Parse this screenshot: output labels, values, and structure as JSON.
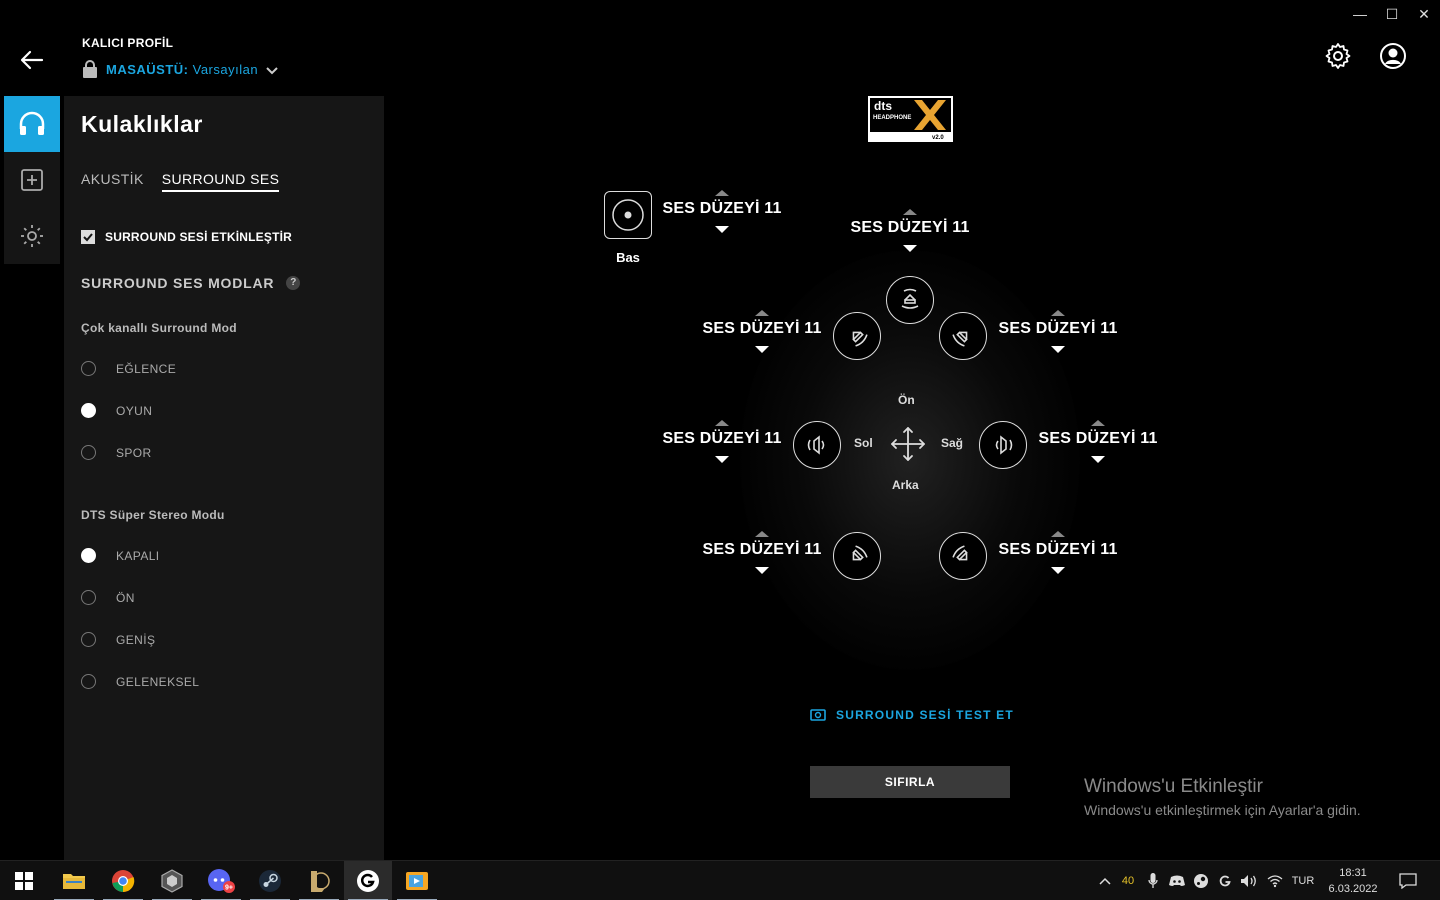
{
  "window": {
    "minimize": "—",
    "maximize": "☐",
    "close": "✕"
  },
  "header": {
    "profile_label": "KALICI PROFİL",
    "profile_kind": "MASAÜSTÜ:",
    "profile_name": "Varsayılan"
  },
  "panel": {
    "title": "Kulaklıklar",
    "tabs": [
      "AKUSTİK",
      "SURROUND SES"
    ],
    "enable_label": "SURROUND SESİ ETKİNLEŞTİR",
    "modes_title": "SURROUND SES MODLAR",
    "help": "?",
    "group1_title": "Çok kanallı Surround Mod",
    "group1_options": [
      "EĞLENCE",
      "OYUN",
      "SPOR"
    ],
    "group1_selected": "OYUN",
    "group2_title": "DTS Süper Stereo Modu",
    "group2_options": [
      "KAPALI",
      "ÖN",
      "GENİŞ",
      "GELENEKSEL"
    ],
    "group2_selected": "KAPALI"
  },
  "main": {
    "bass_label": "Bas",
    "levels": {
      "bass": "SES DÜZEYİ 11",
      "center": "SES DÜZEYİ 11",
      "front_left": "SES DÜZEYİ 11",
      "front_right": "SES DÜZEYİ 11",
      "side_left": "SES DÜZEYİ 11",
      "side_right": "SES DÜZEYİ 11",
      "rear_left": "SES DÜZEYİ 11",
      "rear_right": "SES DÜZEYİ 11"
    },
    "dir_front": "Ön",
    "dir_back": "Arka",
    "dir_left": "Sol",
    "dir_right": "Sağ",
    "test_label": "SURROUND SESİ TEST ET",
    "reset_label": "SIFIRLA",
    "accent": "#1ba6e0"
  },
  "watermark": {
    "line1": "Windows'u Etkinleştir",
    "line2": "Windows'u etkinleştirmek için Ayarlar'a gidin."
  },
  "taskbar": {
    "tray_temp": "40",
    "lang": "TUR",
    "time": "18:31",
    "date": "6.03.2022",
    "badge": "9+"
  }
}
